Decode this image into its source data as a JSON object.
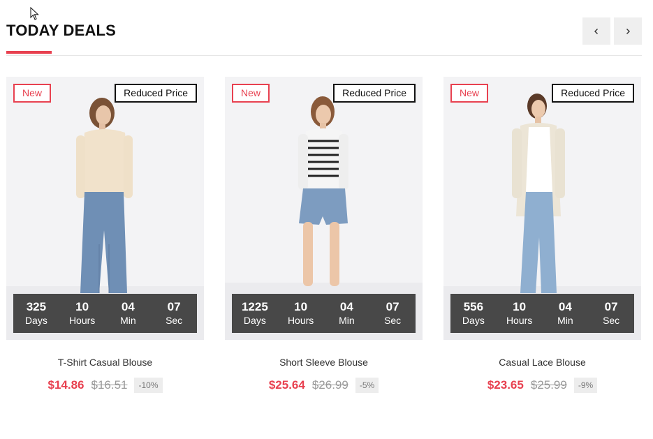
{
  "section": {
    "title": "TODAY DEALS",
    "prev_icon": "chevron-left-icon",
    "next_icon": "chevron-right-icon",
    "accent_color": "#e84150"
  },
  "products": [
    {
      "badge_new": "New",
      "badge_reduced": "Reduced Price",
      "countdown": [
        {
          "value": "325",
          "label": "Days"
        },
        {
          "value": "10",
          "label": "Hours"
        },
        {
          "value": "04",
          "label": "Min"
        },
        {
          "value": "07",
          "label": "Sec"
        }
      ],
      "name": "T-Shirt Casual Blouse",
      "price": "$14.86",
      "old_price": "$16.51",
      "discount": "-10%"
    },
    {
      "badge_new": "New",
      "badge_reduced": "Reduced Price",
      "countdown": [
        {
          "value": "1225",
          "label": "Days"
        },
        {
          "value": "10",
          "label": "Hours"
        },
        {
          "value": "04",
          "label": "Min"
        },
        {
          "value": "07",
          "label": "Sec"
        }
      ],
      "name": "Short Sleeve Blouse",
      "price": "$25.64",
      "old_price": "$26.99",
      "discount": "-5%"
    },
    {
      "badge_new": "New",
      "badge_reduced": "Reduced Price",
      "countdown": [
        {
          "value": "556",
          "label": "Days"
        },
        {
          "value": "10",
          "label": "Hours"
        },
        {
          "value": "04",
          "label": "Min"
        },
        {
          "value": "07",
          "label": "Sec"
        }
      ],
      "name": "Casual Lace Blouse",
      "price": "$23.65",
      "old_price": "$25.99",
      "discount": "-9%"
    }
  ]
}
